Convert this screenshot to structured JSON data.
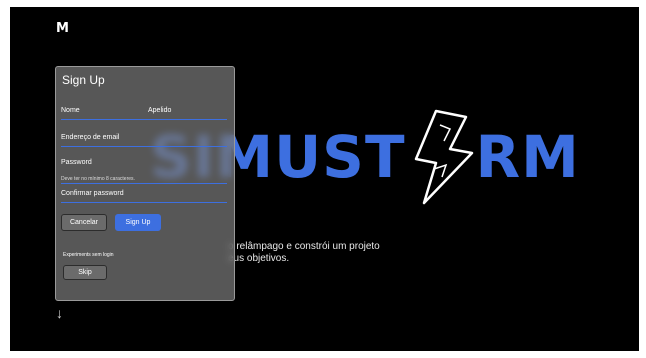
{
  "brand": {
    "logo": "M"
  },
  "hero": {
    "left_text": "SIMU",
    "middle_text": "ST",
    "right_text": "RM"
  },
  "tagline": {
    "line1": "o relâmpago e  constrói um projeto",
    "line2": "eus objetivos."
  },
  "modal": {
    "title": "Sign Up",
    "first_name_label": "Nome",
    "last_name_label": "Apelido",
    "email_label": "Endereço de email",
    "password_label": "Password",
    "password_hint": "Deve ter no mínimo 8 caracteres.",
    "confirm_password_label": "Confirmar password",
    "cancel_label": "Cancelar",
    "signup_label": "Sign Up",
    "experiments_label": "Experiments sem login",
    "skip_label": "Skip"
  },
  "scroll": {
    "arrow": "↓"
  },
  "colors": {
    "accent": "#3d6fe0",
    "background": "#000000"
  }
}
